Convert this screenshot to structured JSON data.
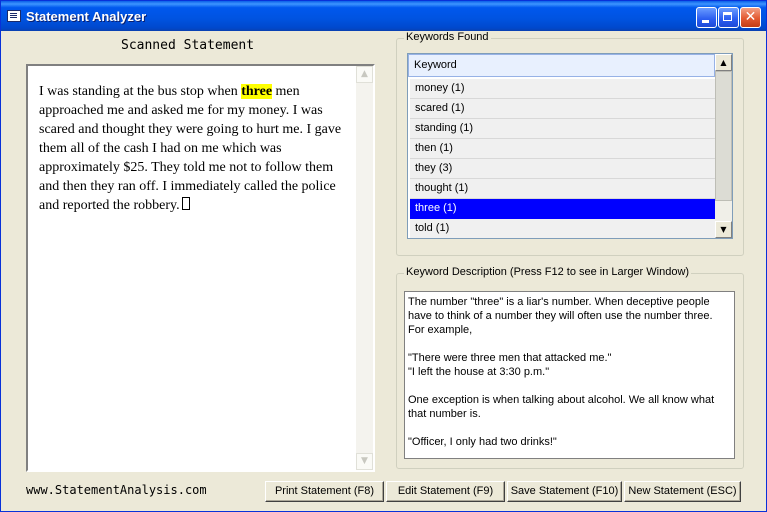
{
  "window": {
    "title": "Statement Analyzer"
  },
  "statement": {
    "heading": "Scanned Statement",
    "text_before": "I was standing at the bus stop when ",
    "highlight": "three",
    "text_after": " men approached me and asked me for my money. I was scared and thought they were going to hurt me. I gave them all of the cash I had on me which was approximately $25. They told me not to follow them and then they ran off. I immediately called the police and reported the robbery."
  },
  "keywords": {
    "group_title": "Keywords Found",
    "column_header": "Keyword",
    "items": [
      "money (1)",
      "scared (1)",
      "standing (1)",
      "then (1)",
      "they (3)",
      "thought (1)",
      "three (1)",
      "told (1)"
    ],
    "selected": "three (1)"
  },
  "description": {
    "group_title": "Keyword Description (Press F12 to see in Larger Window)",
    "paragraphs": [
      "The number \"three\" is a liar's number. When deceptive people have to think of a number they will often use the number three. For example,",
      "\"There were three men that attacked me.\"",
      "\"I left the house at 3:30 p.m.\"",
      "One exception is when talking about alcohol. We all know what that number is.",
      "\"Officer, I only had two drinks!\""
    ]
  },
  "footer": {
    "website": "www.StatementAnalysis.com",
    "print_label": "Print Statement (F8)",
    "edit_label": "Edit Statement (F9)",
    "save_label": "Save Statement (F10)",
    "new_label": "New Statement (ESC)"
  },
  "colors": {
    "highlight": "#ffff00",
    "selection": "#0000ff",
    "titlebar": "#0053e0"
  }
}
